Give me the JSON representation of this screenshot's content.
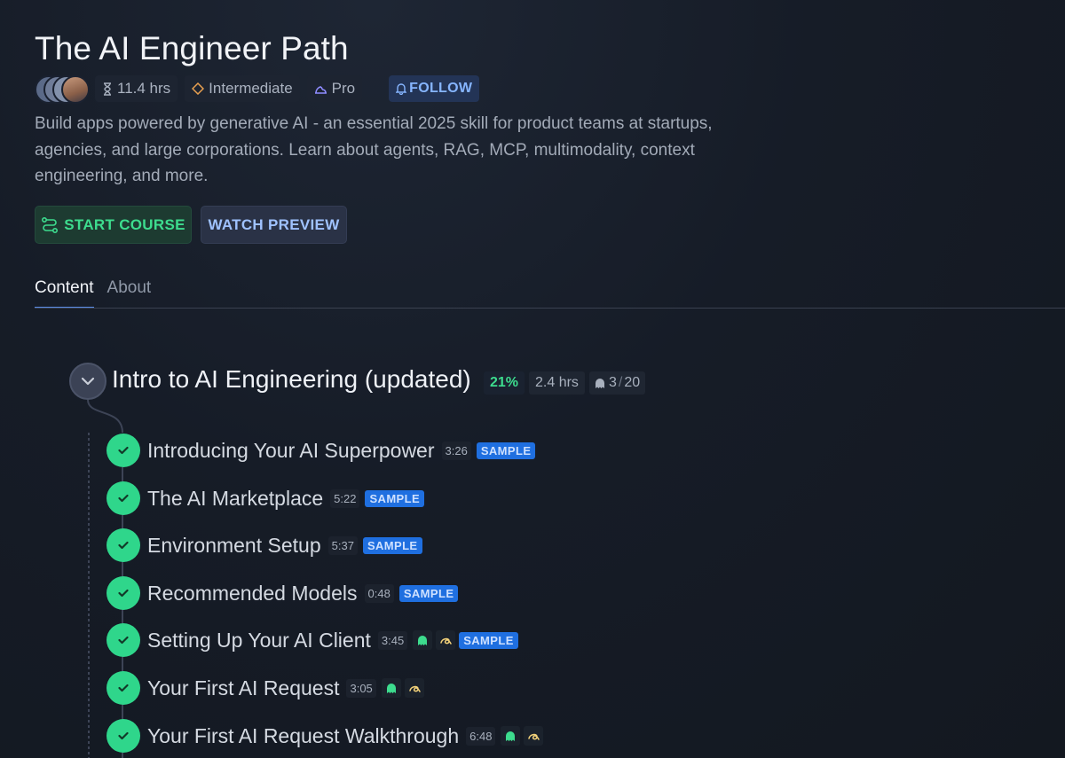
{
  "course": {
    "title": "The AI Engineer Path",
    "duration": "11.4 hrs",
    "level": "Intermediate",
    "tier": "Pro",
    "follow_label": "FOLLOW",
    "description": "Build apps powered by generative AI - an essential 2025 skill for product teams at startups, agencies, and large corporations. Learn about agents, RAG, MCP, multimodality, context engineering, and more.",
    "start_label": "START COURSE",
    "preview_label": "WATCH PREVIEW"
  },
  "tabs": [
    {
      "label": "Content",
      "active": true
    },
    {
      "label": "About",
      "active": false
    }
  ],
  "section": {
    "title": "Intro to AI Engineering (updated)",
    "progress": "21%",
    "duration": "2.4 hrs",
    "challenges_done": "3",
    "challenges_total": "20"
  },
  "lessons": [
    {
      "title": "Introducing Your AI Superpower",
      "duration": "3:26",
      "sample": "SAMPLE"
    },
    {
      "title": "The AI Marketplace",
      "duration": "5:22",
      "sample": "SAMPLE"
    },
    {
      "title": "Environment Setup",
      "duration": "5:37",
      "sample": "SAMPLE"
    },
    {
      "title": "Recommended Models",
      "duration": "0:48",
      "sample": "SAMPLE"
    },
    {
      "title": "Setting Up Your AI Client",
      "duration": "3:45",
      "sample": "SAMPLE"
    },
    {
      "title": "Your First AI Request",
      "duration": "3:05"
    },
    {
      "title": "Your First AI Request Walkthrough",
      "duration": "6:48"
    }
  ],
  "colors": {
    "accent_green": "#3ddc8e",
    "check_green": "#2fd68b",
    "sample_blue": "#1f6fe0",
    "link_blue": "#86b5ff",
    "level_orange": "#e8a050",
    "pro_purple": "#8f8cff"
  },
  "icons": {
    "duration": "hourglass-icon",
    "level": "diamond-icon",
    "tier": "pro-badge-icon",
    "follow": "bell-icon",
    "start": "path-icon",
    "section": "chevron-down-icon",
    "challenge": "ghost-icon",
    "lesson_done": "check-icon",
    "interactive": "scrim-icon"
  }
}
